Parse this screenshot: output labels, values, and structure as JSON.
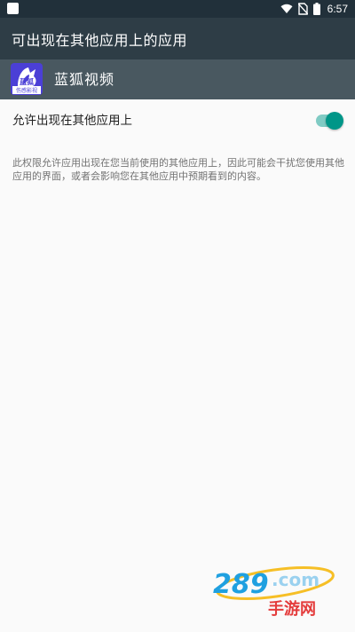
{
  "status_bar": {
    "time": "6:57",
    "background": "#21303a"
  },
  "toolbar": {
    "title": "可出现在其他应用上的应用",
    "background": "#2e3d46"
  },
  "app_header": {
    "app_name": "蓝狐视频",
    "icon_text": "蓝狐",
    "icon_subtext": "伤感影视",
    "background": "#495860"
  },
  "setting": {
    "label": "允许出现在其他应用上",
    "toggle_on": true,
    "accent": "#009688"
  },
  "description": "此权限允许应用出现在您当前使用的其他应用上，因此可能会干扰您使用其他应用的界面，或者会影响您在其他应用中预期看到的内容。",
  "watermark": {
    "number": "289",
    "domain": ".com",
    "caption": "手游网"
  }
}
